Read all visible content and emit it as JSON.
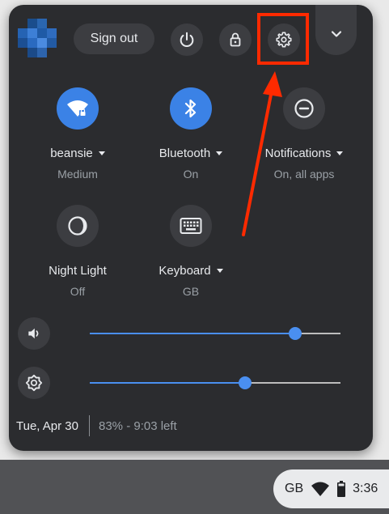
{
  "header": {
    "avatar": "avatar",
    "sign_out_label": "Sign out",
    "power_icon": "power-icon",
    "lock_icon": "lock-icon",
    "settings_icon": "gear-icon",
    "collapse_icon": "chevron-down-icon"
  },
  "features": [
    {
      "label": "beansie",
      "sub": "Medium",
      "icon": "wifi-icon",
      "state": "on",
      "dropdown": true
    },
    {
      "label": "Bluetooth",
      "sub": "On",
      "icon": "bluetooth-icon",
      "state": "on",
      "dropdown": true
    },
    {
      "label": "Notifications",
      "sub": "On, all apps",
      "icon": "do-not-disturb-icon",
      "state": "off",
      "dropdown": true
    },
    {
      "label": "Night Light",
      "sub": "Off",
      "icon": "night-light-icon",
      "state": "off",
      "dropdown": false
    },
    {
      "label": "Keyboard",
      "sub": "GB",
      "icon": "keyboard-icon",
      "state": "off",
      "dropdown": true
    }
  ],
  "sliders": {
    "volume": {
      "icon": "volume-icon",
      "level": 0.82
    },
    "brightness": {
      "icon": "brightness-icon",
      "level": 0.62
    }
  },
  "footer": {
    "date": "Tue, Apr 30",
    "battery": "83% - 9:03 left"
  },
  "tray": {
    "keyboard_layout": "GB",
    "time": "3:36"
  },
  "colors": {
    "panel": "#2b2c2f",
    "accent": "#3b82e6",
    "annotation": "#ff2a00"
  }
}
